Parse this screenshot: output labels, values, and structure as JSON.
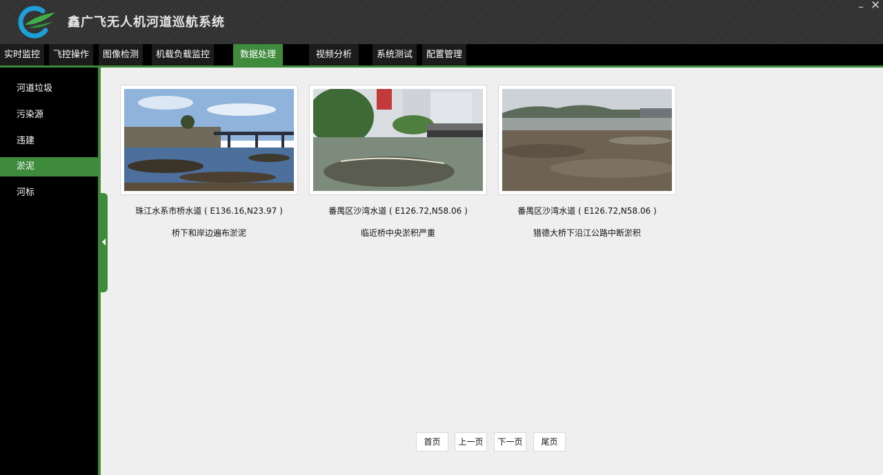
{
  "app": {
    "title": "鑫广飞无人机河道巡航系统",
    "window_controls": {
      "minimize": "–",
      "close": "✕"
    },
    "accent_color": "#3f8b3c"
  },
  "menu": {
    "items": [
      {
        "label": "实时监控"
      },
      {
        "label": "飞控操作"
      },
      {
        "label": "图像检测"
      },
      {
        "label": "机载负载监控"
      },
      {
        "label": "数据处理",
        "active": true
      },
      {
        "label": "视频分析"
      },
      {
        "label": "系统测试"
      },
      {
        "label": "配置管理"
      }
    ]
  },
  "sidebar": {
    "items": [
      {
        "label": "河道垃圾"
      },
      {
        "label": "污染源"
      },
      {
        "label": "违建"
      },
      {
        "label": "淤泥",
        "active": true
      },
      {
        "label": "河标"
      }
    ]
  },
  "gallery": {
    "cards": [
      {
        "caption": "珠江水系市桥水道 ( E136.16,N23.97 )",
        "description": "桥下和岸边遍布淤泥"
      },
      {
        "caption": "番禺区沙湾水道 ( E126.72,N58.06 )",
        "description": "临近桥中央淤积严重"
      },
      {
        "caption": "番禺区沙湾水道 ( E126.72,N58.06 )",
        "description": "猎德大桥下沿江公路中断淤积"
      }
    ]
  },
  "pagination": {
    "first": "首页",
    "prev": "上一页",
    "next": "下一页",
    "last": "尾页"
  }
}
